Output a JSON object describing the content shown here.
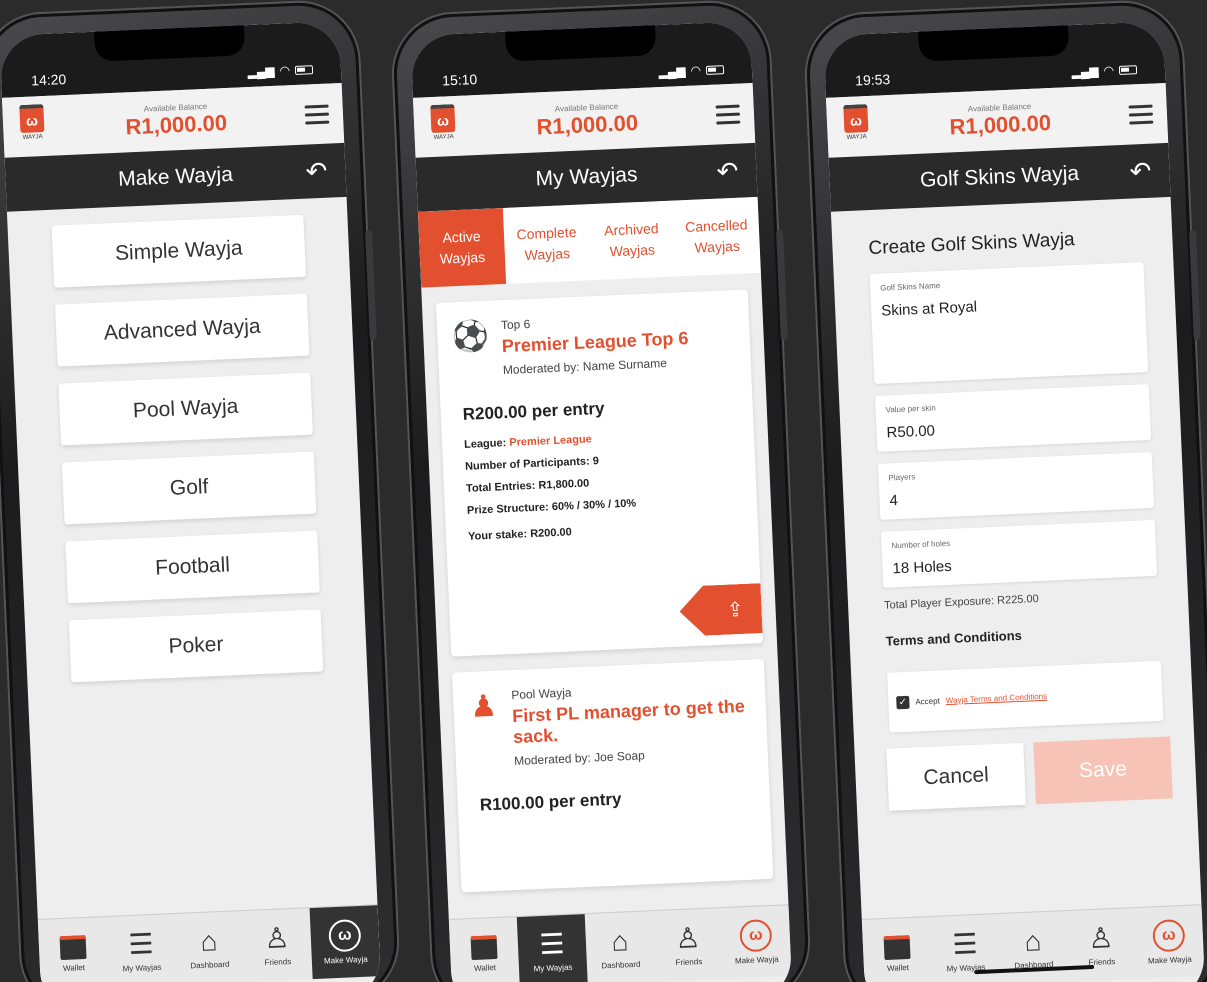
{
  "brand": {
    "logo_text": "WAYJA",
    "accent": "#e2502f"
  },
  "balance": {
    "label": "Available Balance",
    "amount": "R1,000.00"
  },
  "nav": {
    "wallet": "Wallet",
    "my_wayjas": "My Wayjas",
    "dashboard": "Dashboard",
    "friends": "Friends",
    "make_wayja": "Make Wayja"
  },
  "screen1": {
    "time": "14:20",
    "title": "Make Wayja",
    "options": [
      "Simple Wayja",
      "Advanced Wayja",
      "Pool Wayja",
      "Golf",
      "Football",
      "Poker"
    ]
  },
  "screen2": {
    "time": "15:10",
    "title": "My Wayjas",
    "tabs": [
      "Active Wayjas",
      "Complete Wayjas",
      "Archived Wayjas",
      "Cancelled Wayjas"
    ],
    "cards": [
      {
        "subtitle": "Top 6",
        "title": "Premier League Top 6",
        "moderator": "Moderated by: Name Surname",
        "entry": "R200.00 per entry",
        "league_label": "League:",
        "league_value": "Premier League",
        "participants": "Number of Participants: 9",
        "total_entries": "Total Entries: R1,800.00",
        "prize": "Prize Structure: 60% / 30% / 10%",
        "stake": "Your stake: R200.00"
      },
      {
        "subtitle": "Pool Wayja",
        "title": "First PL manager to get the sack.",
        "moderator": "Moderated by: Joe Soap",
        "entry": "R100.00 per entry"
      }
    ]
  },
  "screen3": {
    "time": "19:53",
    "title": "Golf Skins Wayja",
    "form_title": "Create Golf Skins Wayja",
    "fields": [
      {
        "label": "Golf Skins Name",
        "value": "Skins at Royal"
      },
      {
        "label": "Value per skin",
        "value": "R50.00"
      },
      {
        "label": "Players",
        "value": "4"
      },
      {
        "label": "Number of holes",
        "value": "18 Holes"
      }
    ],
    "exposure": "Total Player Exposure: R225.00",
    "terms_title": "Terms and Conditions",
    "accept": "Accept",
    "terms_link": "Wayja Terms and Conditions",
    "cancel": "Cancel",
    "save": "Save"
  }
}
